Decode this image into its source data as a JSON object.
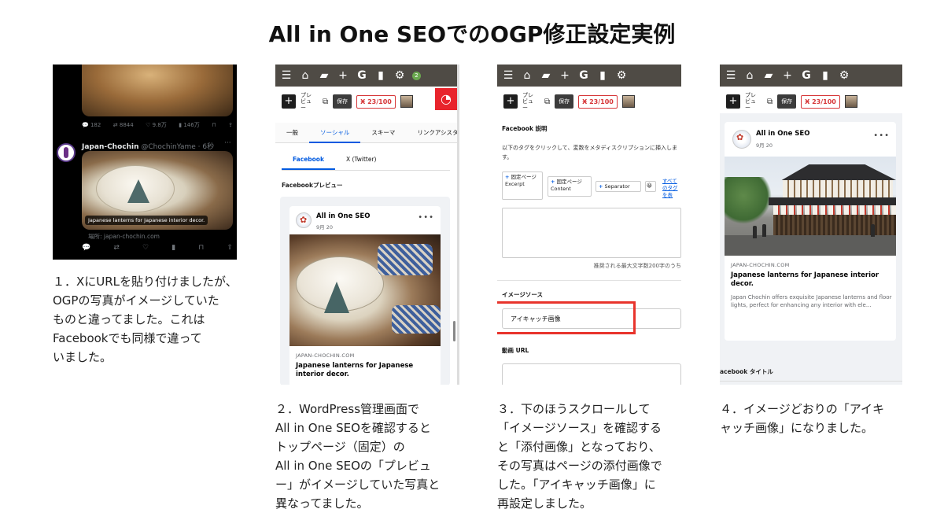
{
  "title": "All in One SEOでのOGP修正設定実例",
  "descriptions": {
    "step1": "１．XにURLを貼り付けましたが、\nOGPの写真がイメージしていた\nものと違ってました。これは\nFacebookでも同様で違って\nいました。",
    "step2": "２．WordPress管理画面で\nAll in One SEOを確認すると\nトップページ（固定）の\nAll in One SEOの「プレビュ\nー」がイメージしていた写真と\n異なってました。",
    "step3": "３．下のほうスクロールして\n「イメージソース」を確認する\nと「添付画像」となっており、\nその写真はページの添付画像で\nした。「アイキャッチ画像」に\n再設定しました。",
    "step4": "４．イメージどおりの「アイキ\nャッチ画像」になりました。"
  },
  "x_post": {
    "top_actions": [
      "182",
      "8844",
      "9.8万",
      "146万"
    ],
    "author": "Japan-Chochin",
    "handle": "@ChochinYame · 6秒",
    "card_caption": "Japanese lanterns for Japanese interior decor.",
    "from": "場所: japan-chochin.com"
  },
  "wp": {
    "plus": "+",
    "preview": "プレ ビュ ー",
    "save": "保存",
    "score": "23/100",
    "notif": "2"
  },
  "panel2": {
    "tabs": [
      "一般",
      "ソーシャル",
      "スキーマ",
      "リンクアシスタン"
    ],
    "subtabs": [
      "Facebook",
      "X (Twitter)"
    ],
    "preview_label": "Facebookプレビュー",
    "site_name": "All in One SEO",
    "date": "9月 20",
    "domain": "JAPAN-CHOCHIN.COM",
    "link_title": "Japanese lanterns for Japanese interior decor."
  },
  "panel3": {
    "heading": "Facebook 説明",
    "help": "以下のタグをクリックして、変数をメタディスクリプションに挿入します。",
    "tag1": "固定ページ Excerpt",
    "tag2": "固定ページ Content",
    "tag3": "Separator",
    "tag_more": "すべてのタグを表",
    "count": "推奨される最大文字数200字のうち",
    "image_source_label": "イメージソース",
    "image_source_value": "アイキャッチ画像",
    "video_label": "動画 URL"
  },
  "panel4": {
    "site_name": "All in One SEO",
    "date": "9月 20",
    "domain": "JAPAN-CHOCHIN.COM",
    "link_title": "Japanese lanterns for Japanese interior decor.",
    "link_text": "Japan Chochin offers exquisite Japanese lanterns and floor lights, perfect for enhancing any interior with ele...",
    "bottom_label": "acebook タイトル"
  }
}
